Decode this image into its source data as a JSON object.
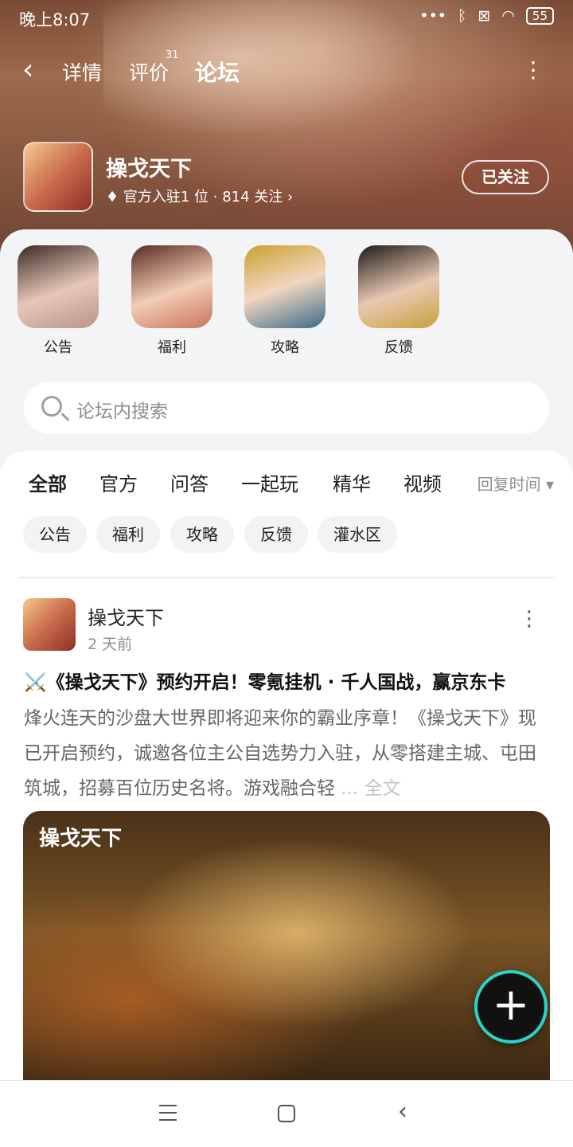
{
  "status": {
    "time": "晚上8:07",
    "battery": "55"
  },
  "nav": {
    "tabs": [
      {
        "label": "详情"
      },
      {
        "label": "评价",
        "badge": "31"
      },
      {
        "label": "论坛",
        "active": true
      }
    ]
  },
  "game": {
    "title": "操戈天下",
    "meta": "官方入驻1 位 · 814 关注 ›",
    "follow_label": "已关注"
  },
  "shortcuts": [
    {
      "label": "公告"
    },
    {
      "label": "福利"
    },
    {
      "label": "攻略"
    },
    {
      "label": "反馈"
    }
  ],
  "search": {
    "placeholder": "论坛内搜索"
  },
  "feed": {
    "tabs": [
      {
        "label": "全部",
        "active": true
      },
      {
        "label": "官方"
      },
      {
        "label": "问答"
      },
      {
        "label": "一起玩"
      },
      {
        "label": "精华"
      },
      {
        "label": "视频"
      }
    ],
    "sort": "回复时间 ▾",
    "tags": [
      "公告",
      "福利",
      "攻略",
      "反馈",
      "灌水区"
    ]
  },
  "post": {
    "author": "操戈天下",
    "time": "2 天前",
    "title": "⚔️《操戈天下》预约开启！零氪挂机 · 千人国战，赢京东卡",
    "body": "烽火连天的沙盘大世界即将迎来你的霸业序章！《操戈天下》现已开启预约，诚邀各位主公自选势力入驻，从零搭建主城、屯田筑城，招募百位历史名将。游戏融合轻",
    "ellipsis": " ... ",
    "fulltext": "全文",
    "image_logo": "操戈天下"
  },
  "colors": {
    "accent": "#19d3c5"
  }
}
